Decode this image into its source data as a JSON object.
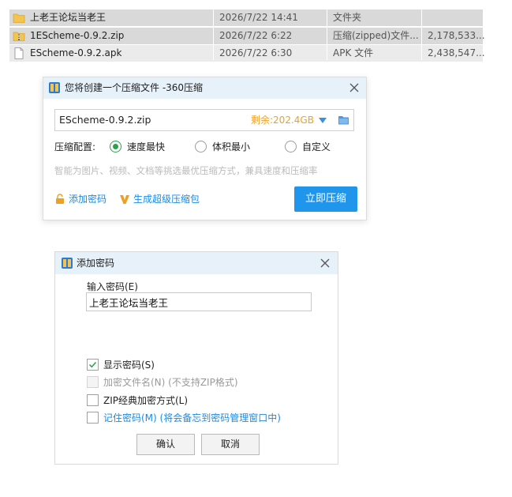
{
  "explorer": {
    "files": [
      {
        "name": "上老王论坛当老王",
        "date": "2026/7/22 14:41",
        "type": "文件夹",
        "size": "",
        "icon": "folder-icon"
      },
      {
        "name": "1EScheme-0.9.2.zip",
        "date": "2026/7/22 6:22",
        "type": "压缩(zipped)文件...",
        "size": "2,178,533...",
        "icon": "zip-folder-icon"
      },
      {
        "name": "EScheme-0.9.2.apk",
        "date": "2026/7/22 6:30",
        "type": "APK 文件",
        "size": "2,438,547...",
        "icon": "file-icon"
      }
    ]
  },
  "compress_dialog": {
    "title": "您将创建一个压缩文件 -360压缩",
    "filename": "EScheme-0.9.2.zip",
    "remaining": "剩余:202.4GB",
    "options_label": "压缩配置:",
    "options": [
      "速度最快",
      "体积最小",
      "自定义"
    ],
    "selected_option": "速度最快",
    "hint": "智能为图片、视频、文档等挑选最优压缩方式，兼具速度和压缩率",
    "add_password": "添加密码",
    "super_compress": "生成超级压缩包",
    "compress_now": "立即压缩"
  },
  "password_dialog": {
    "title": "添加密码",
    "input_label": "输入密码(E)",
    "password_value": "上老王论坛当老王",
    "checkboxes": [
      {
        "label": "显示密码(S)",
        "checked": true,
        "disabled": false
      },
      {
        "label": "加密文件名(N) (不支持ZIP格式)",
        "checked": false,
        "disabled": true
      },
      {
        "label": "ZIP经典加密方式(L)",
        "checked": false,
        "disabled": false
      },
      {
        "label": "记住密码(M) (将会备忘到密码管理窗口中)",
        "checked": false,
        "disabled": false
      }
    ],
    "ok": "确认",
    "cancel": "取消"
  },
  "colors": {
    "accent_blue": "#1f95ec",
    "link_blue": "#1a8be6",
    "remaining_orange": "#f0a020",
    "radio_green": "#2aa14a",
    "titlebar": "#e7f1fa",
    "selection_gray": "#d9d9d9"
  }
}
